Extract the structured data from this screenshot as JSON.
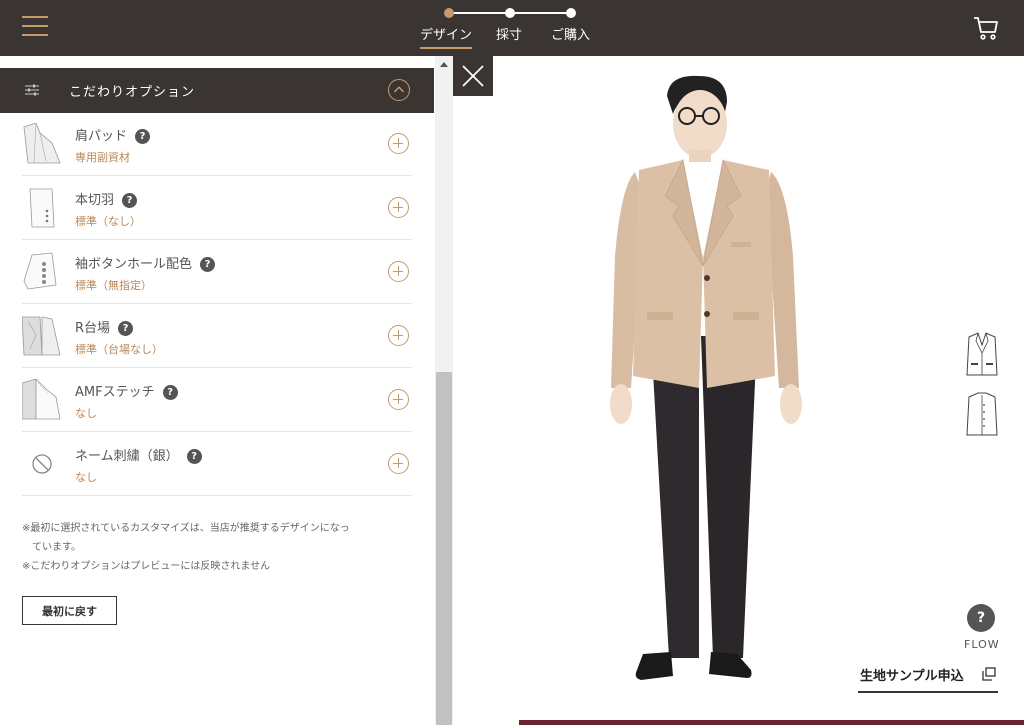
{
  "header": {
    "steps": [
      {
        "label": "デザイン"
      },
      {
        "label": "採寸"
      },
      {
        "label": "ご購入"
      }
    ]
  },
  "panel": {
    "title": "こだわりオプション",
    "options": [
      {
        "name": "肩パッド",
        "value": "専用副資材",
        "icon": "shoulder-pad-icon"
      },
      {
        "name": "本切羽",
        "value": "標準（なし）",
        "icon": "sleeve-cuff-icon"
      },
      {
        "name": "袖ボタンホール配色",
        "value": "標準（無指定）",
        "icon": "sleeve-buttons-icon"
      },
      {
        "name": "R台場",
        "value": "標準（台場なし）",
        "icon": "lining-icon"
      },
      {
        "name": "AMFステッチ",
        "value": "なし",
        "icon": "lapel-stitch-icon"
      },
      {
        "name": "ネーム刺繍（銀）",
        "value": "なし",
        "icon": "no-embroidery-icon"
      }
    ],
    "help_symbol": "?",
    "notes": [
      "※最初に選択されているカスタマイズは、当店が推奨するデザインになっ",
      "　ています。",
      "※こだわりオプションはプレビューには反映されません"
    ],
    "reset_label": "最初に戻す"
  },
  "preview": {
    "flow_symbol": "?",
    "flow_label": "FLOW",
    "sample_label": "生地サンプル申込"
  },
  "colors": {
    "dark": "#3a3533",
    "accent": "#c79a6c",
    "jacket": "#dcc0a6",
    "trousers": "#2e2a2d"
  }
}
